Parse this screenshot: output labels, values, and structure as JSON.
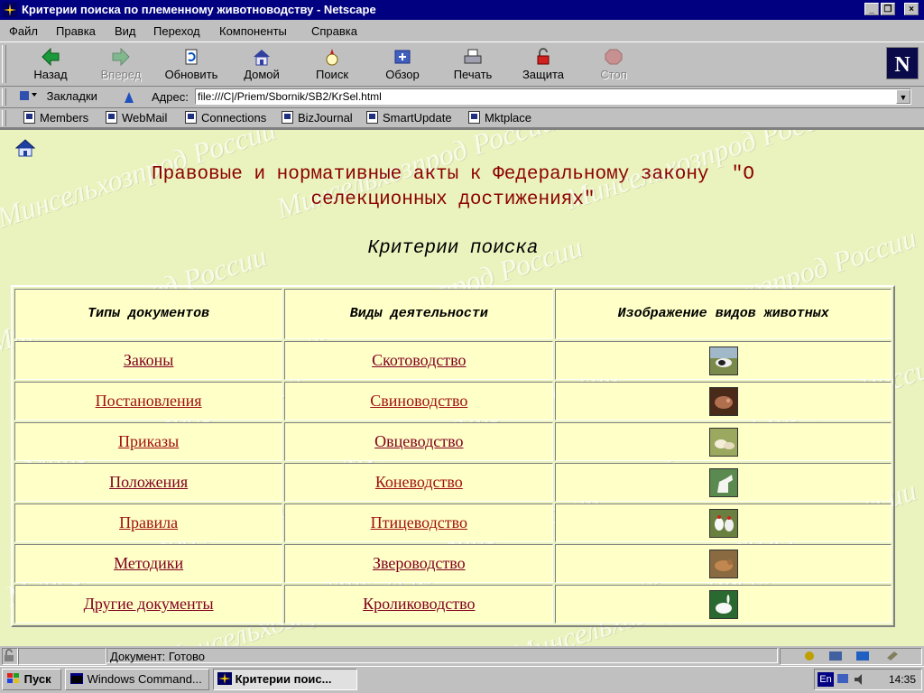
{
  "window": {
    "title": "Критерии поиска по племенному животноводству - Netscape",
    "buttons": {
      "minimize": "_",
      "restore": "❐",
      "close": "×"
    }
  },
  "menubar": [
    "Файл",
    "Правка",
    "Вид",
    "Переход",
    "Компоненты",
    "Справка"
  ],
  "toolbar": {
    "buttons": [
      {
        "label": "Назад",
        "icon": "back-arrow-icon",
        "enabled": true
      },
      {
        "label": "Вперед",
        "icon": "forward-arrow-icon",
        "enabled": false
      },
      {
        "label": "Обновить",
        "icon": "reload-icon",
        "enabled": true
      },
      {
        "label": "Домой",
        "icon": "home-icon",
        "enabled": true
      },
      {
        "label": "Поиск",
        "icon": "search-icon",
        "enabled": true
      },
      {
        "label": "Обзор",
        "icon": "guide-icon",
        "enabled": true
      },
      {
        "label": "Печать",
        "icon": "print-icon",
        "enabled": true
      },
      {
        "label": "Защита",
        "icon": "security-lock-icon",
        "enabled": true
      },
      {
        "label": "Стоп",
        "icon": "stop-icon",
        "enabled": false
      }
    ],
    "logo": "N"
  },
  "location": {
    "bookmarks_label": "Закладки",
    "address_label": "Адрес:",
    "url": "file:///C|/Priem/Sbornik/SB2/KrSel.html"
  },
  "personal_toolbar": [
    "Members",
    "WebMail",
    "Connections",
    "BizJournal",
    "SmartUpdate",
    "Mktplace"
  ],
  "page": {
    "heading_line1": "Правовые и нормативные акты к Федеральному закону  \"О",
    "heading_line2": "селекционных достижениях\"",
    "subheading": "Критерии поиска",
    "watermark": "Минсельхозпрод России",
    "table": {
      "headers": [
        "Типы документов",
        "Виды деятельности",
        "Изображение видов животных"
      ],
      "rows": [
        {
          "doc": "Законы",
          "activity": "Скотоводство",
          "image": "cattle-photo"
        },
        {
          "doc": "Постановления",
          "activity": "Свиноводство",
          "image": "pig-photo"
        },
        {
          "doc": "Приказы",
          "activity": "Овцеводство",
          "image": "sheep-photo"
        },
        {
          "doc": "Положения",
          "activity": "Коневодство",
          "image": "horse-photo"
        },
        {
          "doc": "Правила",
          "activity": "Птицеводство",
          "image": "poultry-photo"
        },
        {
          "doc": "Методики",
          "activity": "Звероводство",
          "image": "fur-animal-photo"
        },
        {
          "doc": "Другие документы",
          "activity": "Кролиководство",
          "image": "rabbit-photo"
        }
      ]
    },
    "colors": {
      "background": "#eaf3bd",
      "cell": "#ffffc8",
      "heading": "#8b0000",
      "link": "#a01010"
    }
  },
  "statusbar": {
    "text": "Документ: Готово"
  },
  "taskbar": {
    "start": "Пуск",
    "tasks": [
      "Windows Command...",
      "Критерии поис..."
    ],
    "lang": "En",
    "clock": "14:35"
  }
}
